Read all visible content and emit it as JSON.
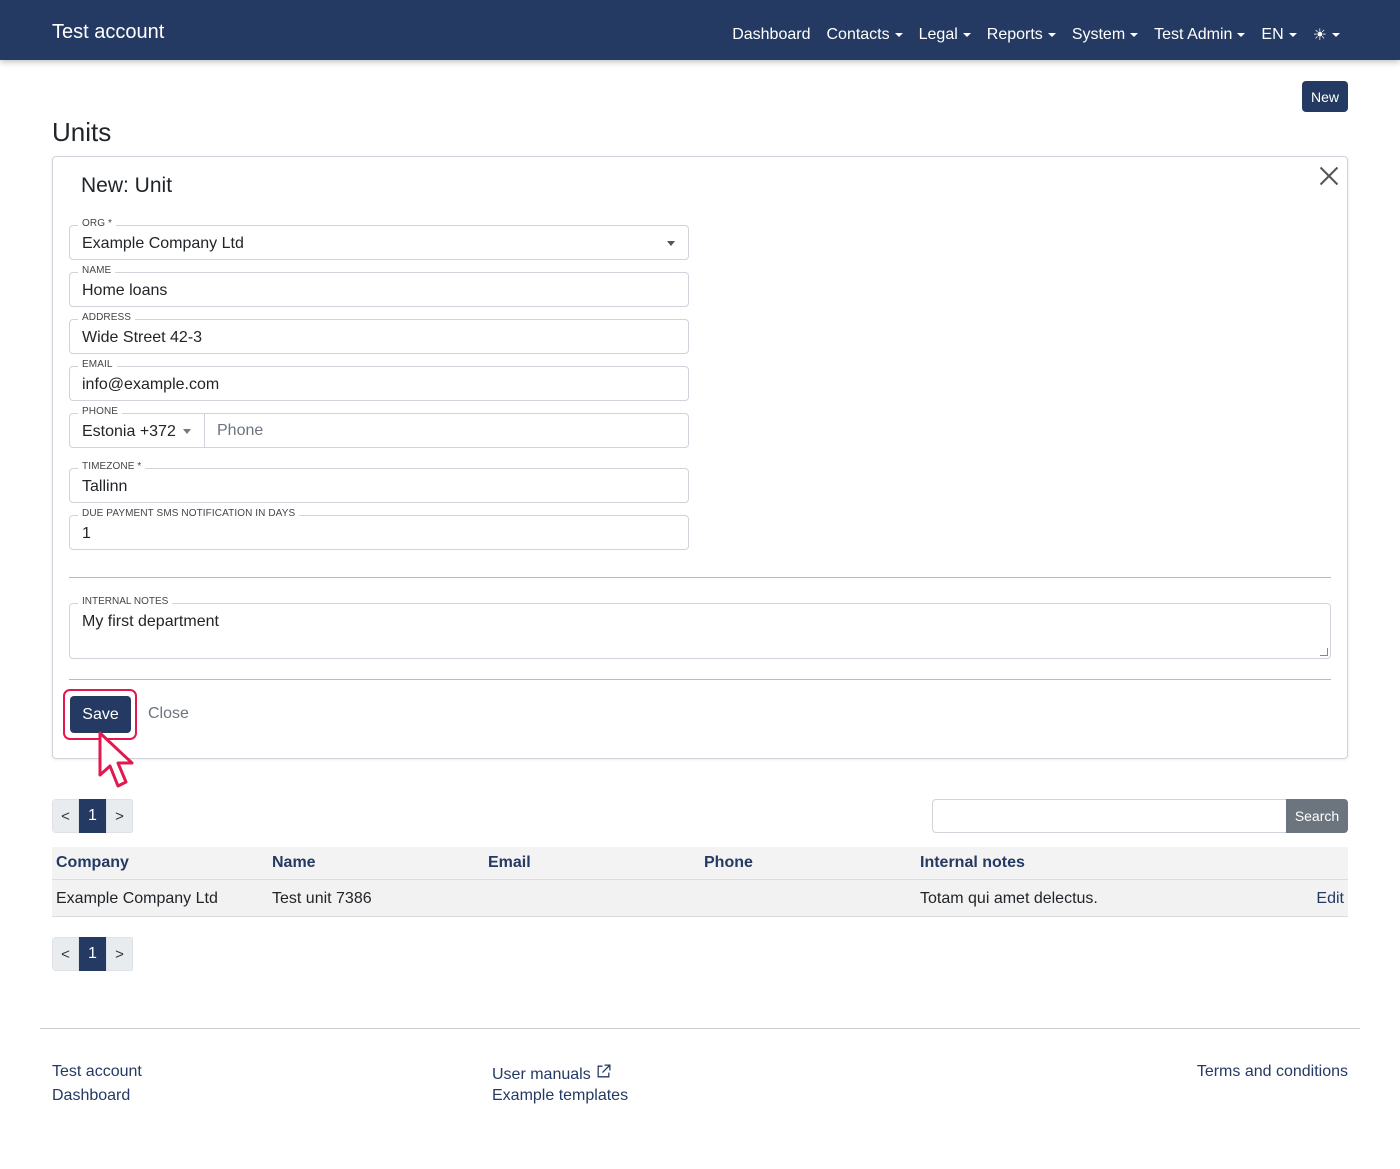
{
  "navbar": {
    "brand": "Test account",
    "items": [
      {
        "label": "Dashboard",
        "dropdown": false
      },
      {
        "label": "Contacts",
        "dropdown": true
      },
      {
        "label": "Legal",
        "dropdown": true
      },
      {
        "label": "Reports",
        "dropdown": true
      },
      {
        "label": "System",
        "dropdown": true
      },
      {
        "label": "Test Admin",
        "dropdown": true
      },
      {
        "label": "EN",
        "dropdown": true
      }
    ],
    "theme_icon": "☀"
  },
  "page": {
    "title": "Units",
    "new_button": "New"
  },
  "form": {
    "title": "New: Unit",
    "org": {
      "label": "ORG *",
      "value": "Example Company Ltd"
    },
    "name": {
      "label": "NAME",
      "value": "Home loans"
    },
    "address": {
      "label": "ADDRESS",
      "value": "Wide Street 42-3"
    },
    "email": {
      "label": "EMAIL",
      "value": "info@example.com"
    },
    "phone": {
      "label": "PHONE",
      "country": "Estonia +372",
      "placeholder": "Phone"
    },
    "timezone": {
      "label": "TIMEZONE *",
      "value": "Tallinn"
    },
    "due_payment": {
      "label": "DUE PAYMENT SMS NOTIFICATION IN DAYS",
      "value": "1"
    },
    "notes": {
      "label": "INTERNAL NOTES",
      "value": "My first department"
    },
    "save_label": "Save",
    "close_label": "Close"
  },
  "pagination": {
    "prev": "<",
    "current": "1",
    "next": ">"
  },
  "search": {
    "button": "Search",
    "value": ""
  },
  "table": {
    "columns": [
      "Company",
      "Name",
      "Email",
      "Phone",
      "Internal notes"
    ],
    "rows": [
      {
        "company": "Example Company Ltd",
        "name": "Test unit 7386",
        "email": "",
        "phone": "",
        "notes": "Totam qui amet delectus.",
        "action": "Edit"
      }
    ]
  },
  "footer": {
    "left": [
      "Test account",
      "Dashboard"
    ],
    "middle": [
      "User manuals",
      "Example templates"
    ],
    "right": "Terms and conditions"
  },
  "colors": {
    "primary": "#243a63",
    "highlight": "#e0194f",
    "muted": "#6c757d"
  }
}
